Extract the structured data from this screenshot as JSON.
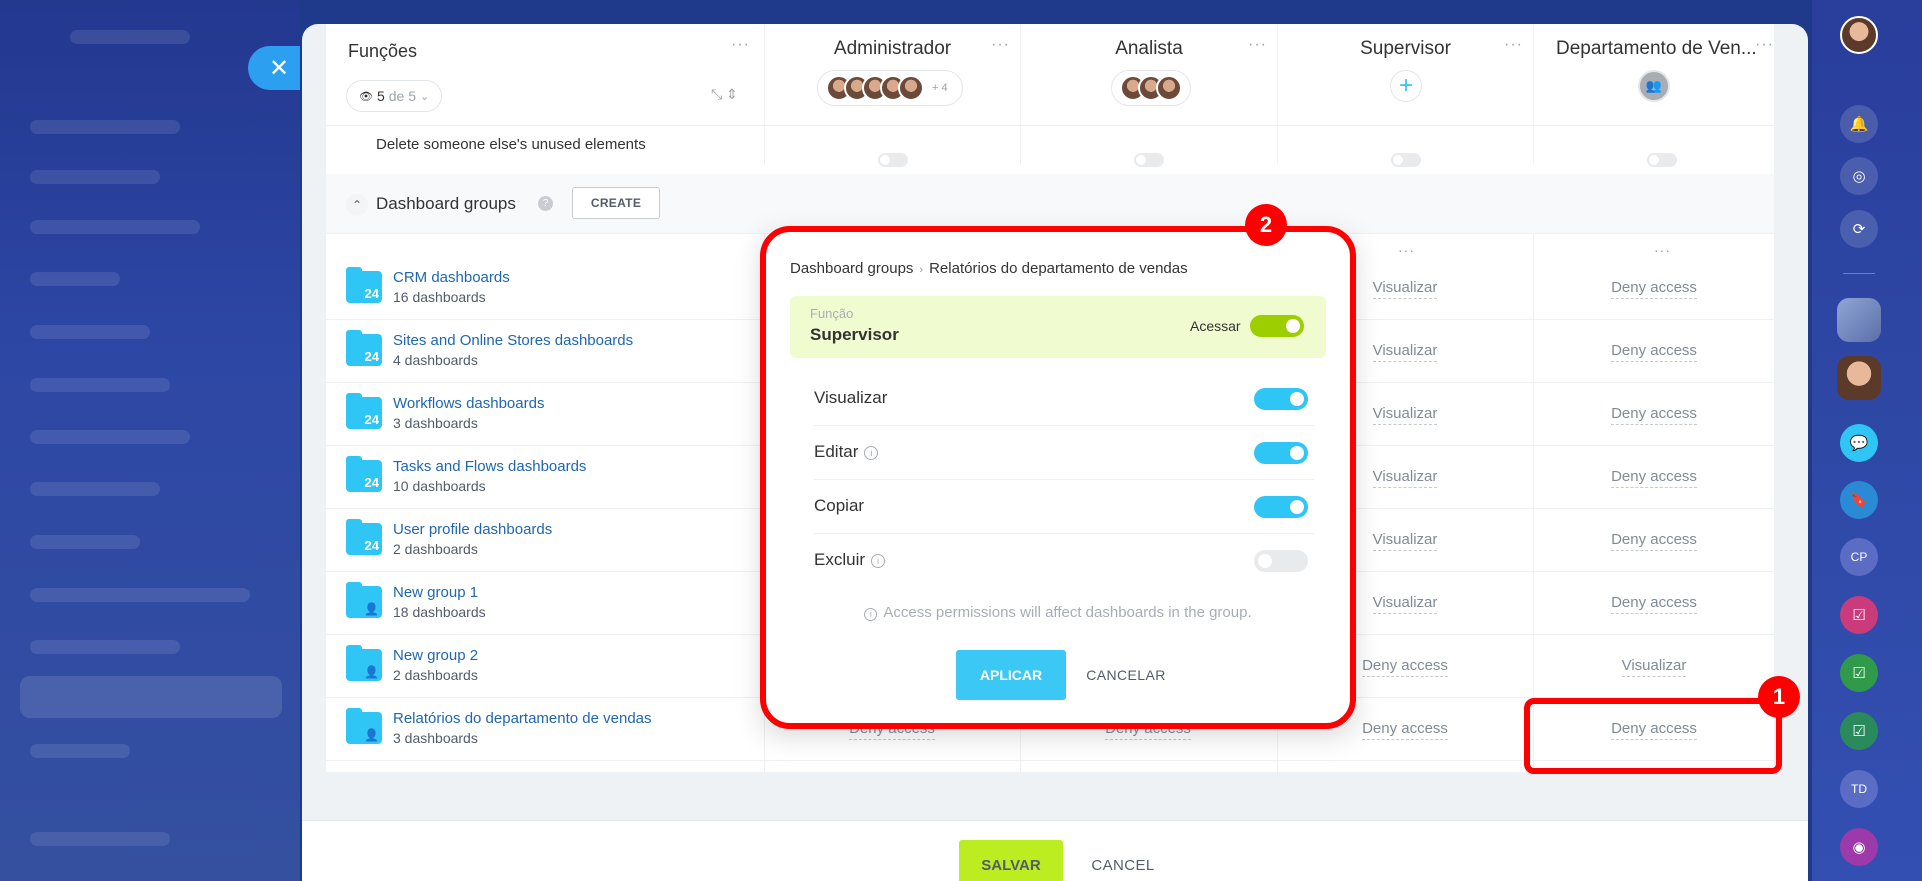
{
  "background": {
    "close_icon": "close-icon"
  },
  "header": {
    "functions_title": "Funções",
    "counter_value": "5",
    "counter_suffix": "de 5",
    "columns": [
      {
        "title": "Administrador",
        "avatar_extra": "+ 4"
      },
      {
        "title": "Analista"
      },
      {
        "title": "Supervisor"
      },
      {
        "title": "Departamento de Ven..."
      }
    ]
  },
  "delete_row": {
    "label": "Delete someone else's unused elements"
  },
  "section": {
    "title": "Dashboard groups",
    "create_label": "CREATE"
  },
  "groups": [
    {
      "name": "CRM dashboards",
      "count": "16 dashboards",
      "icon": "24",
      "supervisor": "Visualizar",
      "dept": "Deny access"
    },
    {
      "name": "Sites and Online Stores dashboards",
      "count": "4 dashboards",
      "icon": "24",
      "supervisor": "Visualizar",
      "dept": "Deny access"
    },
    {
      "name": "Workflows dashboards",
      "count": "3 dashboards",
      "icon": "24",
      "supervisor": "Visualizar",
      "dept": "Deny access"
    },
    {
      "name": "Tasks and Flows dashboards",
      "count": "10 dashboards",
      "icon": "24",
      "supervisor": "Visualizar",
      "dept": "Deny access"
    },
    {
      "name": "User profile dashboards",
      "count": "2 dashboards",
      "icon": "24",
      "supervisor": "Visualizar",
      "dept": "Deny access"
    },
    {
      "name": "New group 1",
      "count": "18 dashboards",
      "icon": "user",
      "supervisor": "Visualizar",
      "dept": "Deny access"
    },
    {
      "name": "New group 2",
      "count": "2 dashboards",
      "icon": "user",
      "supervisor": "Deny access",
      "dept": "Visualizar"
    },
    {
      "name": "Relatórios do departamento de vendas",
      "count": "3 dashboards",
      "icon": "user",
      "admin": "Deny access",
      "analista": "Deny access",
      "supervisor": "Deny access",
      "dept": "Deny access"
    }
  ],
  "popup": {
    "crumb_root": "Dashboard groups",
    "crumb_leaf": "Relatórios do departamento de vendas",
    "role_label": "Função",
    "role_value": "Supervisor",
    "access_label": "Acessar",
    "permissions": [
      {
        "label": "Visualizar",
        "enabled": true,
        "info": false
      },
      {
        "label": "Editar",
        "enabled": true,
        "info": true
      },
      {
        "label": "Copiar",
        "enabled": true,
        "info": false
      },
      {
        "label": "Excluir",
        "enabled": false,
        "info": true
      }
    ],
    "note": "Access permissions will affect dashboards in the group.",
    "apply_label": "APLICAR",
    "cancel_label": "CANCELAR"
  },
  "annotations": {
    "badge_1": "1",
    "badge_2": "2"
  },
  "footer": {
    "save_label": "SALVAR",
    "cancel_label": "CANCEL"
  },
  "right_bar": {
    "chip_1": "CP",
    "chip_2": "TD"
  },
  "colors": {
    "accent_blue": "#2fc6f6",
    "save_green": "#bbed21",
    "annotation_red": "#ff0000",
    "link_blue": "#2067b0"
  }
}
